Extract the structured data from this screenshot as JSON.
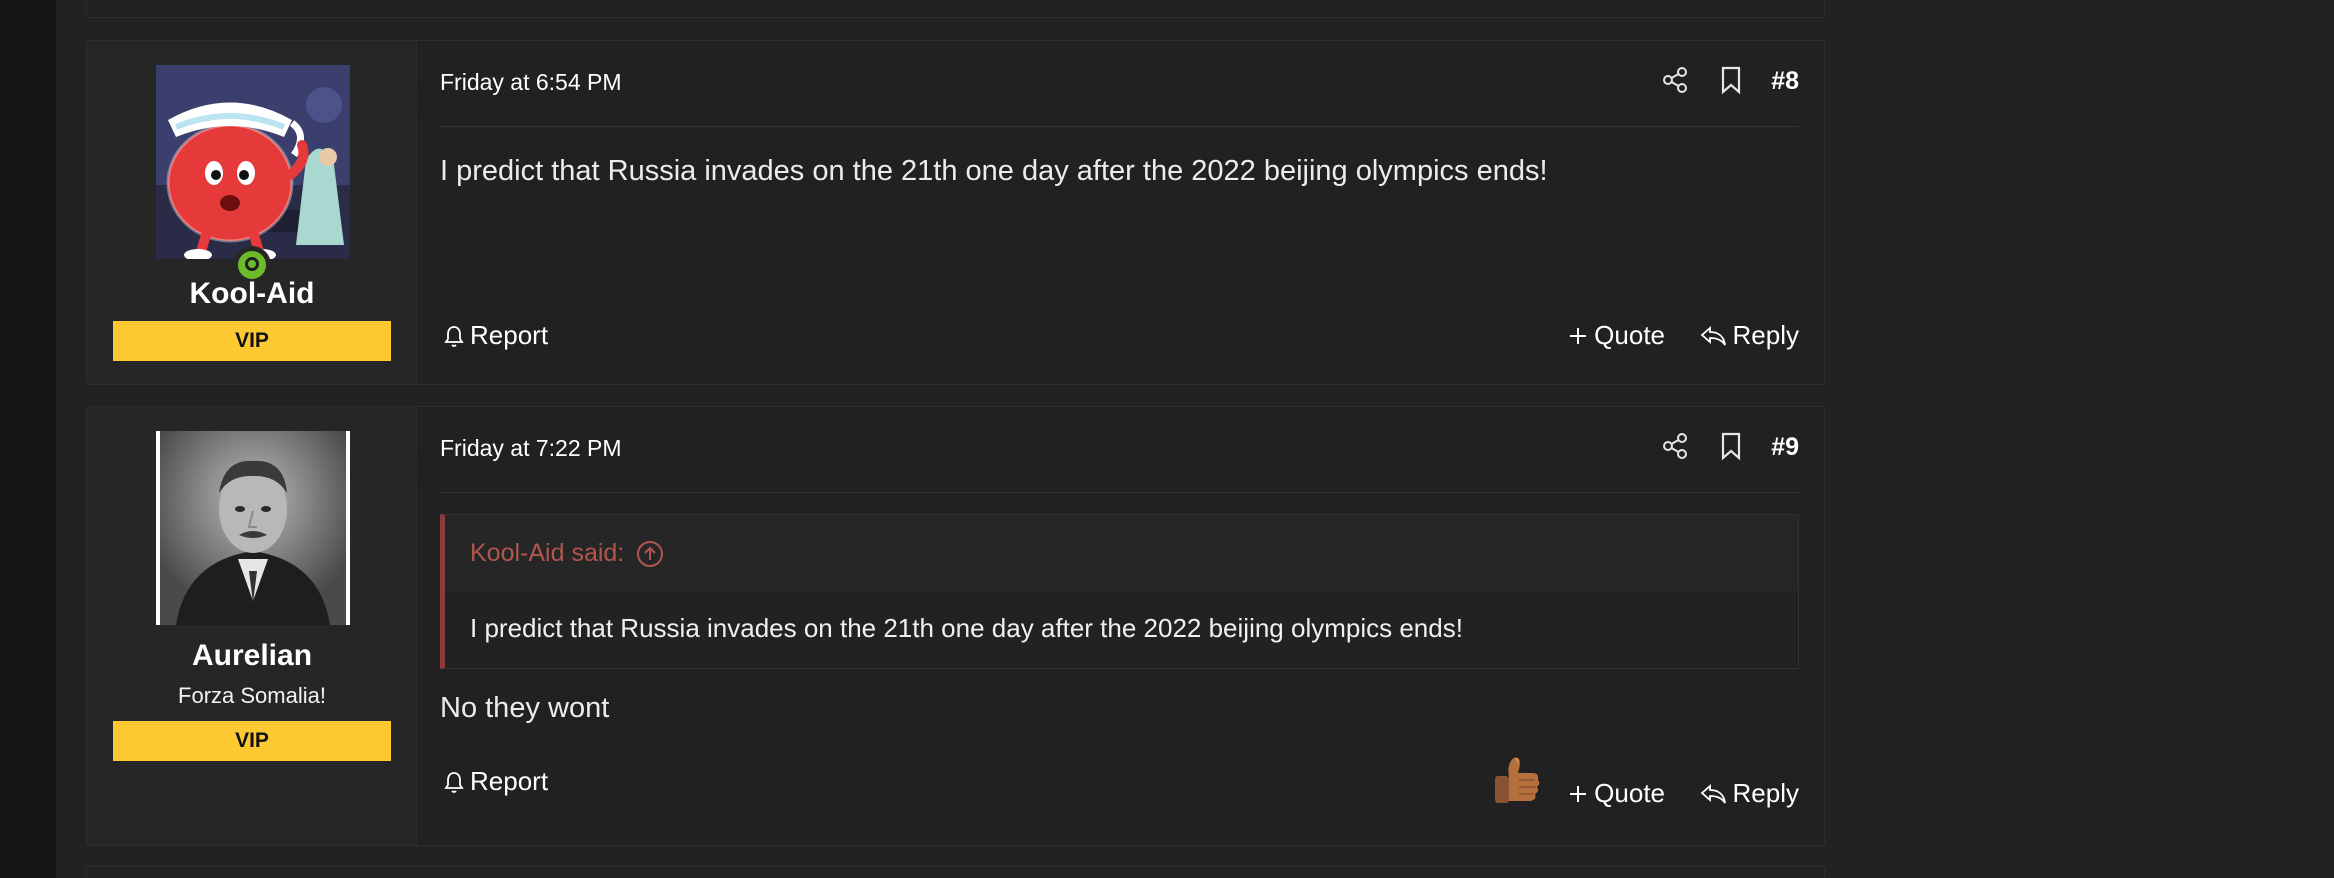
{
  "colors": {
    "background": "#222222",
    "panel": "#212121",
    "user_column": "#262626",
    "vip_badge": "#fcc933",
    "quote_border": "#8f3a3a",
    "quote_attribution": "#b1554f",
    "online_indicator": "#6dba2a"
  },
  "posts": [
    {
      "timestamp": "Friday at 6:54 PM",
      "post_number": "#8",
      "author": {
        "name": "Kool-Aid",
        "title": "",
        "badge": "VIP",
        "online": true,
        "avatar": "kool-aid-man-avatar"
      },
      "message": "I predict that Russia invades on the 21th one day after the 2022 beijing olympics ends!",
      "actions": {
        "report": "Report",
        "quote": "Quote",
        "reply": "Reply"
      },
      "icons": [
        "share-icon",
        "bookmark-icon",
        "bell-icon",
        "plus-icon",
        "reply-arrow-icon"
      ]
    },
    {
      "timestamp": "Friday at 7:22 PM",
      "post_number": "#9",
      "author": {
        "name": "Aurelian",
        "title": "Forza Somalia!",
        "badge": "VIP",
        "online": false,
        "avatar": "bw-portrait-avatar"
      },
      "quote": {
        "attribution": "Kool-Aid said:",
        "text": "I predict that Russia invades on the 21th one day after the 2022 beijing olympics ends!"
      },
      "message": "No they wont",
      "reaction": "thumbs-up-emoji",
      "actions": {
        "report": "Report",
        "quote": "Quote",
        "reply": "Reply"
      },
      "icons": [
        "share-icon",
        "bookmark-icon",
        "bell-icon",
        "plus-icon",
        "reply-arrow-icon",
        "arrow-up-circle-icon"
      ]
    }
  ]
}
